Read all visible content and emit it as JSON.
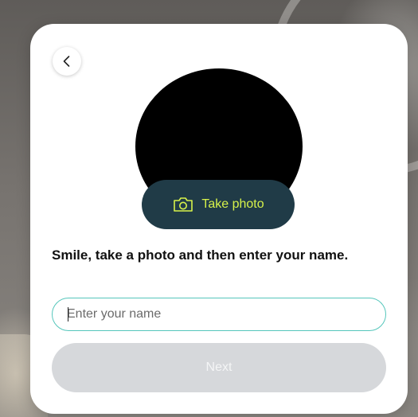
{
  "modal": {
    "back_icon": "chevron-left-icon",
    "take_photo": {
      "icon": "camera-icon",
      "label": "Take photo"
    },
    "instruction": "Smile, take a photo and then enter your name.",
    "name_input": {
      "placeholder": "Enter your name",
      "value": ""
    },
    "next_label": "Next"
  },
  "colors": {
    "take_photo_background": "#203b47",
    "take_photo_accent": "#d7f24a",
    "input_border": "#55c6bb",
    "next_disabled_background": "#d6d8db"
  }
}
